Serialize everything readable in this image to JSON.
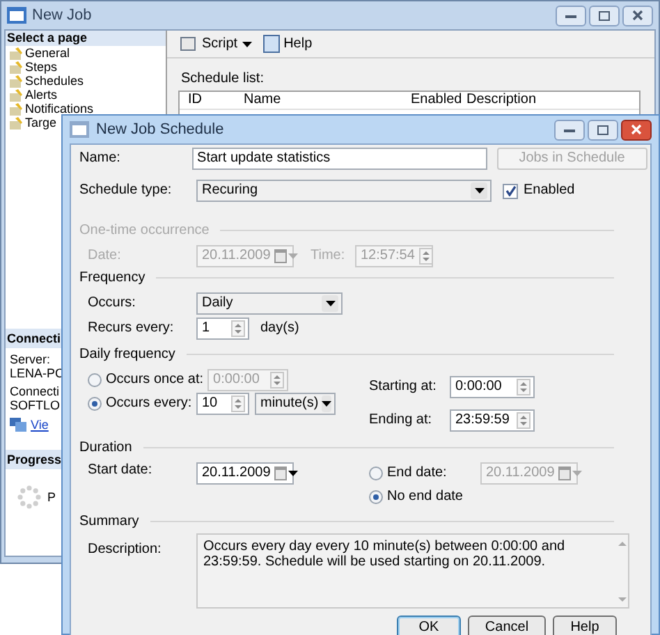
{
  "main_window": {
    "title": "New Job",
    "pages_header": "Select a page",
    "pages": [
      {
        "label": "General"
      },
      {
        "label": "Steps"
      },
      {
        "label": "Schedules"
      },
      {
        "label": "Alerts"
      },
      {
        "label": "Notifications"
      },
      {
        "label": "Targe"
      }
    ],
    "toolbar": [
      {
        "label": "Script",
        "kind": "dropdown"
      },
      {
        "label": "Help",
        "kind": "button"
      }
    ],
    "schedule_list": {
      "label": "Schedule list:",
      "columns": [
        "ID",
        "Name",
        "Enabled",
        "Description"
      ]
    },
    "connection": {
      "header": "Connecti",
      "server_label": "Server:",
      "server": "LENA-PC",
      "connection_label": "Connecti",
      "connection": "SOFTLO",
      "link": "Vie"
    },
    "progress": {
      "header": "Progress",
      "status": "P"
    }
  },
  "dialog": {
    "title": "New Job Schedule",
    "name": {
      "label": "Name:",
      "value": "Start update statistics"
    },
    "jobs_button": {
      "label": "Jobs in Schedule",
      "disabled": true
    },
    "schedule_type": {
      "label": "Schedule type:",
      "value": "Recuring"
    },
    "enabled": {
      "label": "Enabled",
      "checked": true
    },
    "one_time": {
      "title": "One-time occurrence",
      "disabled": true,
      "date_label": "Date:",
      "date": "20.11.2009",
      "time_label": "Time:",
      "time": "12:57:54"
    },
    "frequency": {
      "title": "Frequency",
      "occurs_label": "Occurs:",
      "occurs": "Daily",
      "recurs_label": "Recurs every:",
      "recurs_value": "1",
      "recurs_unit": "day(s)"
    },
    "daily_frequency": {
      "title": "Daily frequency",
      "options": [
        {
          "label": "Occurs once at:",
          "selected": false,
          "value": "0:00:00"
        },
        {
          "label": "Occurs every:",
          "selected": true,
          "value": "10",
          "unit": "minute(s)"
        }
      ],
      "starting_label": "Starting at:",
      "starting": "0:00:00",
      "ending_label": "Ending at:",
      "ending": "23:59:59"
    },
    "duration": {
      "title": "Duration",
      "start_label": "Start date:",
      "start": "20.11.2009",
      "end_options": [
        {
          "label": "End date:",
          "selected": false,
          "value": "20.11.2009"
        },
        {
          "label": "No end date",
          "selected": true
        }
      ]
    },
    "summary": {
      "title": "Summary",
      "description_label": "Description:",
      "description": "Occurs every day every 10 minute(s) between 0:00:00 and 23:59:59. Schedule will be used starting on 20.11.2009."
    },
    "buttons": [
      {
        "label": "OK",
        "default": true
      },
      {
        "label": "Cancel",
        "default": false
      },
      {
        "label": "Help",
        "default": false
      }
    ]
  }
}
